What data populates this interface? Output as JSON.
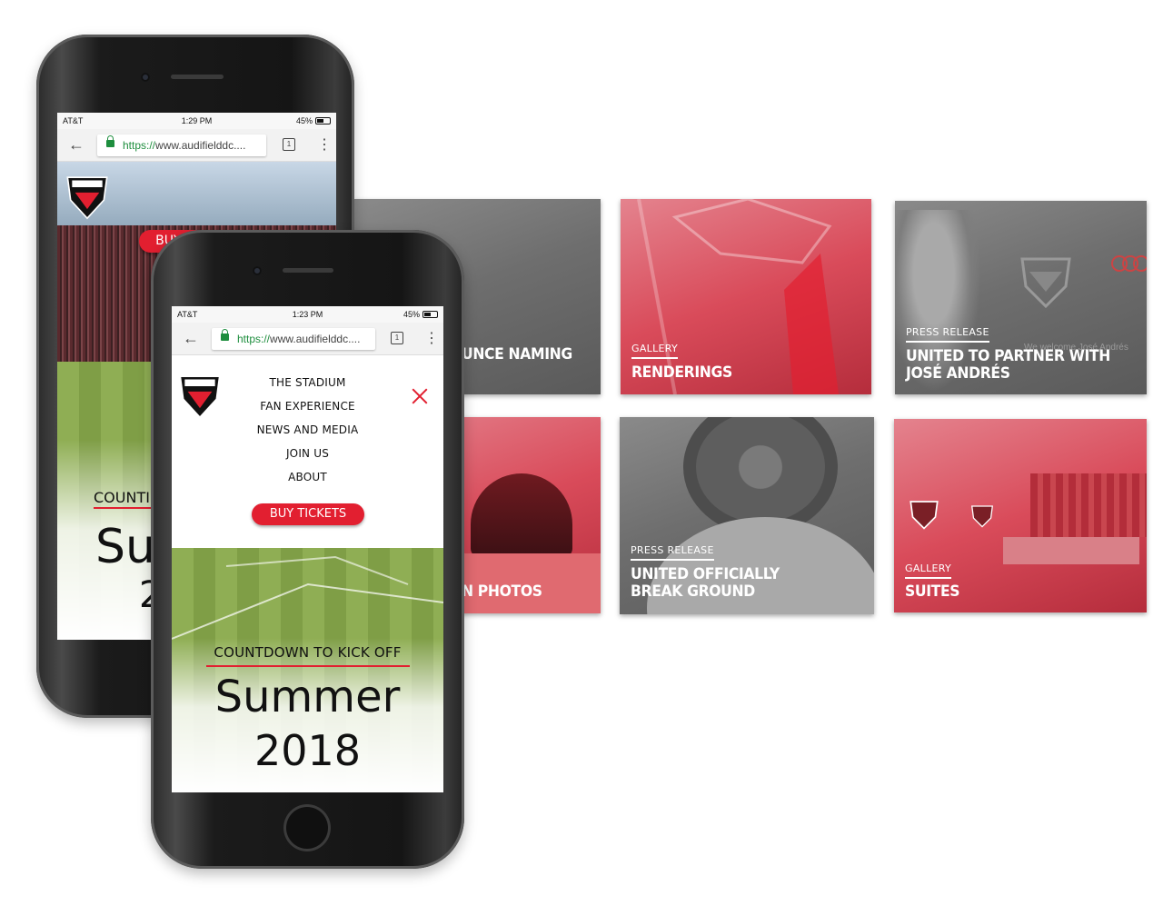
{
  "colors": {
    "accent": "#e21f30",
    "tile_gray": "#707070",
    "tile_red": "#d94b5a"
  },
  "tiles": [
    {
      "category": "",
      "title": "UNCE NAMING",
      "style": "gray"
    },
    {
      "category": "GALLERY",
      "title": "RENDERINGS",
      "style": "red"
    },
    {
      "category": "PRESS RELEASE",
      "title": "UNITED TO PARTNER WITH JOSÉ ANDRÉS",
      "style": "gray",
      "background_caption": "We welcome José Andrés"
    },
    {
      "category": "",
      "title": "N PHOTOS",
      "style": "red"
    },
    {
      "category": "PRESS RELEASE",
      "title": "UNITED OFFICIALLY BREAK GROUND",
      "style": "gray"
    },
    {
      "category": "GALLERY",
      "title": "SUITES",
      "style": "red"
    }
  ],
  "phone_back": {
    "status": {
      "carrier": "AT&T",
      "time": "1:29 PM",
      "battery": "45%"
    },
    "url": {
      "scheme": "https://",
      "host": "www.audifielddc....",
      "tab_count": "1"
    },
    "header": {
      "buy_tickets": "BUY TICKETS",
      "logo_text": "DC UNITED"
    },
    "countdown_partial": "COUNTI",
    "big_partial_1": "Su",
    "big_partial_2": "2"
  },
  "phone_front": {
    "status": {
      "carrier": "AT&T",
      "time": "1:23 PM",
      "battery": "45%"
    },
    "url": {
      "scheme": "https://",
      "host": "www.audifielddc....",
      "tab_count": "1"
    },
    "logo_text": "DC UNITED",
    "menu": [
      "THE STADIUM",
      "FAN EXPERIENCE",
      "NEWS AND MEDIA",
      "JOIN US",
      "ABOUT"
    ],
    "buy_tickets": "BUY TICKETS",
    "countdown_label": "COUNTDOWN TO KICK OFF",
    "season": "Summer",
    "year": "2018"
  }
}
